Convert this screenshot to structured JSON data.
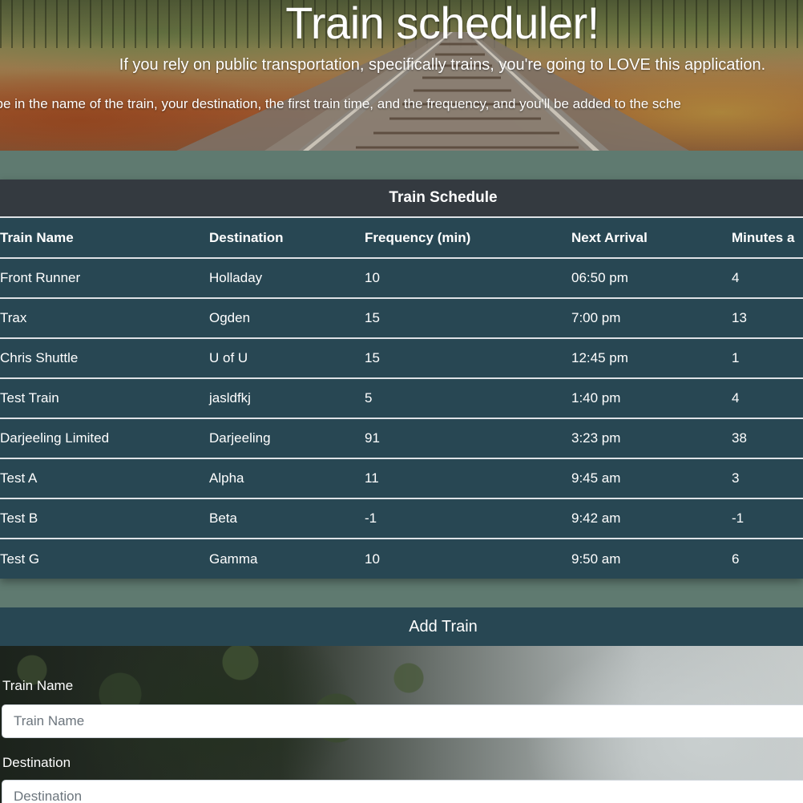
{
  "hero": {
    "title": "Train scheduler!",
    "subtitle": "If you rely on public transportation, specifically trains, you're going to LOVE this application.",
    "instructions": "ype in the name of the train, your destination, the first train time, and the frequency, and you'll be added to the sche"
  },
  "schedule": {
    "title": "Train Schedule",
    "columns": [
      "Train Name",
      "Destination",
      "Frequency (min)",
      "Next Arrival",
      "Minutes a"
    ],
    "rows": [
      [
        "Front Runner",
        "Holladay",
        "10",
        "06:50 pm",
        "4"
      ],
      [
        "Trax",
        "Ogden",
        "15",
        "7:00 pm",
        "13"
      ],
      [
        "Chris Shuttle",
        "U of U",
        "15",
        "12:45 pm",
        "1"
      ],
      [
        "Test Train",
        "jasldfkj",
        "5",
        "1:40 pm",
        "4"
      ],
      [
        "Darjeeling Limited",
        "Darjeeling",
        "91",
        "3:23 pm",
        "38"
      ],
      [
        "Test A",
        "Alpha",
        "11",
        "9:45 am",
        "3"
      ],
      [
        "Test B",
        "Beta",
        "-1",
        "9:42 am",
        "-1"
      ],
      [
        "Test G",
        "Gamma",
        "10",
        "9:50 am",
        "6"
      ]
    ]
  },
  "add_train": {
    "title": "Add Train",
    "train_name_label": "Train Name",
    "train_name_placeholder": "Train Name",
    "destination_label": "Destination",
    "destination_placeholder": "Destination"
  },
  "colors": {
    "table_bg": "#284753",
    "table_header_bg": "#343a40",
    "page_bg": "#5f7a70"
  }
}
